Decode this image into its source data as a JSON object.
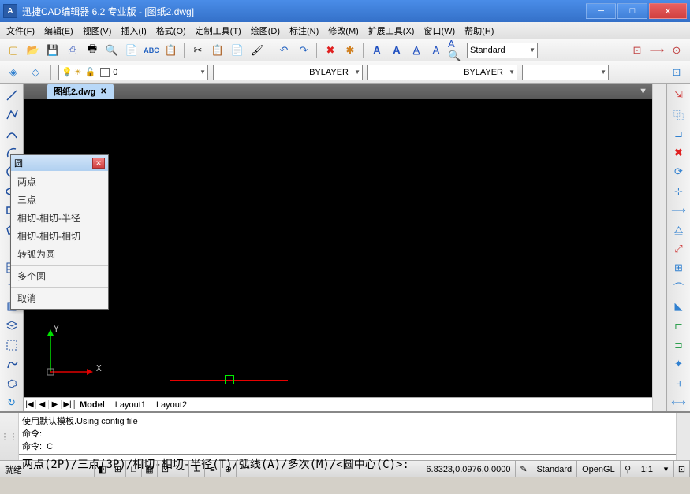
{
  "title": "迅捷CAD编辑器 6.2 专业版  - [图纸2.dwg]",
  "menus": [
    "文件(F)",
    "编辑(E)",
    "视图(V)",
    "插入(I)",
    "格式(O)",
    "定制工具(T)",
    "绘图(D)",
    "标注(N)",
    "修改(M)",
    "扩展工具(X)",
    "窗口(W)",
    "帮助(H)"
  ],
  "textstyle": "Standard",
  "layer": {
    "current": "0",
    "bylayer1": "BYLAYER",
    "bylayer2": "BYLAYER"
  },
  "tab": {
    "name": "图纸2.dwg"
  },
  "modeltabs": {
    "model": "Model",
    "layout1": "Layout1",
    "layout2": "Layout2"
  },
  "ucs": {
    "x": "X",
    "y": "Y"
  },
  "cmd": {
    "line1": "使用默认模板.Using config file",
    "line2": "命令:",
    "line3": "命令:  C",
    "prompt": "两点(2P)/三点(3P)/相切-相切-半径(T)/弧线(A)/多次(M)/<圆中心(C)>:"
  },
  "status": {
    "ready": "就绪",
    "coords": "6.8323,0.0976,0.0000",
    "std": "Standard",
    "gl": "OpenGL",
    "scale": "1:1"
  },
  "popup": {
    "title": "圆",
    "items": [
      "两点",
      "三点",
      "相切-相切-半径",
      "相切-相切-相切",
      "转弧为圆"
    ],
    "items2": [
      "多个圆"
    ],
    "items3": [
      "取消"
    ]
  }
}
